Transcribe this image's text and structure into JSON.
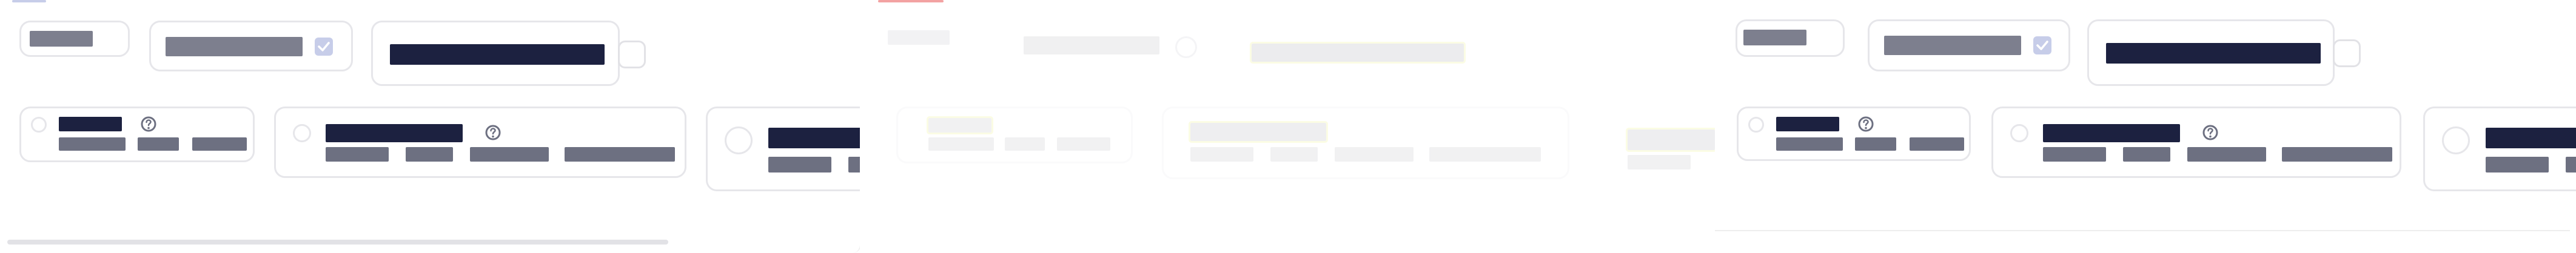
{
  "panels": [
    {
      "id": "left",
      "label": "",
      "visible_state": "normal"
    },
    {
      "id": "middle",
      "label": "",
      "visible_state": "faded"
    },
    {
      "id": "right",
      "label": "",
      "visible_state": "normal"
    }
  ],
  "colors": {
    "accent_blue": "#c7cde9",
    "accent_red": "#f08b8b",
    "dark_bar": "#1c2140",
    "muted_bar": "#6d7081",
    "card_border": "#e6e6ea",
    "highlight": "#f2f6b3"
  },
  "icons": {
    "help": "question-circle",
    "checkbox_checked": "check"
  }
}
